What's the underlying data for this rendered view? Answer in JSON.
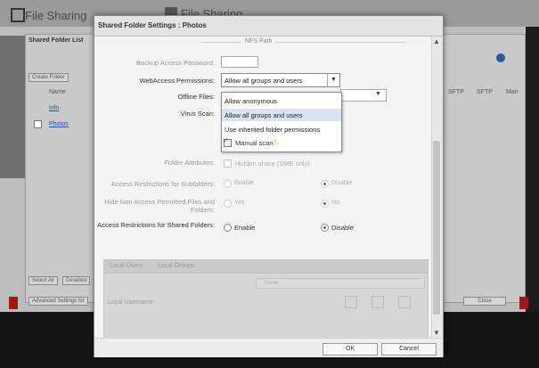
{
  "background": {
    "app_title_left": "File Sharing",
    "app_title_right": "File Sharing",
    "panel_title": "Shared Folder List",
    "create_folder": "Create Folder",
    "col_name": "Name",
    "row1": "info",
    "row2": "Photos",
    "select_all": "Select All",
    "deselect": "Deselect",
    "advanced_settings": "Advanced Settings for",
    "close": "Close",
    "col_sftp": "SFTP",
    "col_man": "Man"
  },
  "dialog": {
    "title": "Shared Folder Settings : Photos",
    "section_header": "NFS Path",
    "fields": {
      "backup_password_label": "Backup Access Password:",
      "webaccess_label": "WebAccess Permissions:",
      "webaccess_value": "Allow all groups and users",
      "offline_files_label": "Offline Files:",
      "virus_scan_label": "Virus Scan:",
      "manual_scan_label": "Manual scan",
      "folder_attributes_label": "Folder Attributes:",
      "folder_attributes_value": "Hidden share (SMB only)",
      "subfolders_label": "Access Restrictions for Subfolders:",
      "hide_label": "Hide Non Access Permitted Files and Folders:",
      "shared_folders_label": "Access Restrictions for Shared Folders:",
      "enable": "Enable",
      "disable": "Disable",
      "yes": "Yes",
      "no": "No"
    },
    "dropdown_options": [
      "Allow anonymous",
      "Allow all groups and users",
      "Use inherited folder permissions"
    ],
    "tabs": {
      "local_users": "Local Users",
      "local_groups": "Local Groups"
    },
    "filter_label": "Show",
    "local_user_name": "Local Username",
    "ok": "OK",
    "cancel": "Cancel"
  }
}
